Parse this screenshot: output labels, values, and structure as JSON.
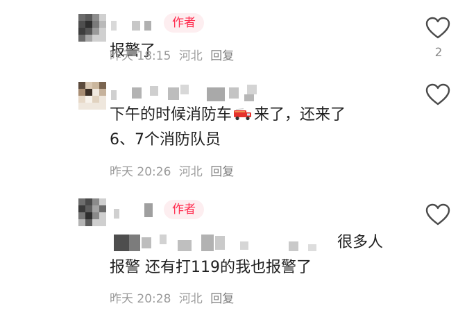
{
  "comments": [
    {
      "badge": "作者",
      "text": "报警了",
      "time": "昨天 18:15",
      "location": "河北",
      "reply": "回复",
      "likes": "2"
    },
    {
      "text_part1": "下午的时候消防车",
      "text_part2": "来了，还来了",
      "text_line2": "6、7个消防队员",
      "time": "昨天 20:26",
      "location": "河北",
      "reply": "回复",
      "likes": ""
    },
    {
      "badge": "作者",
      "text_tail": "很多人",
      "text_line2": "报警 还有打119的我也报警了",
      "time": "昨天 20:28",
      "location": "河北",
      "reply": "回复",
      "likes": ""
    }
  ],
  "icons": {
    "like": "heart-outline-icon",
    "truck": "fire-truck-emoji-icon"
  },
  "colors": {
    "author_badge_bg": "#fdeef0",
    "author_badge_text": "#ff2a4d",
    "meta_text": "#9b9b9b"
  }
}
